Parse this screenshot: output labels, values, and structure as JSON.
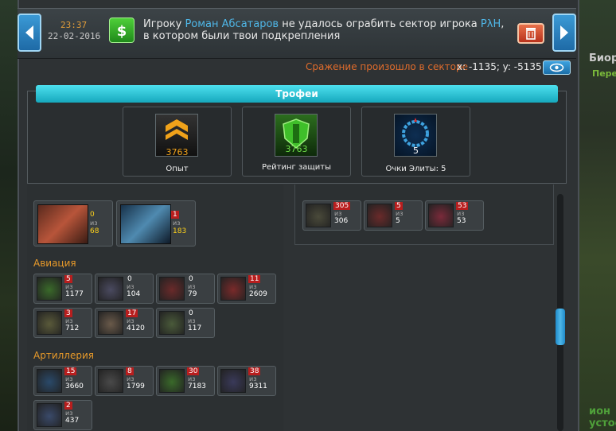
{
  "header": {
    "time": "23:37",
    "date": "22-02-2016",
    "message_prefix": "Игроку",
    "player_victim": "Роман Абсатаров",
    "message_mid": "не удалось ограбить сектор игрока",
    "player_owner": "PλH",
    "message_suffix": "в котором были твои подкрепления",
    "battle_text": "Сражение произошло в секторе",
    "coords": "x: -1135; y: -5135"
  },
  "trophies": {
    "title": "Трофеи",
    "items": [
      {
        "label": "Опыт",
        "value": "3763",
        "icon": "experience-icon"
      },
      {
        "label": "Рейтинг защиты",
        "value": "3763",
        "icon": "shield-rating-icon"
      },
      {
        "label": "Очки Элиты: 5",
        "value": "5",
        "icon": "elite-wreath-icon"
      }
    ]
  },
  "right_side": {
    "title": "Биор",
    "subtitle": "Перер",
    "footer1": "ион",
    "footer2": "устос"
  },
  "units_left": {
    "top": [
      {
        "lost": "0",
        "of": "из",
        "total": "68"
      },
      {
        "lost": "1",
        "of": "из",
        "total": "183"
      }
    ],
    "aviation_title": "Авиация",
    "aviation": [
      {
        "lost": "5",
        "of": "из",
        "total": "1177"
      },
      {
        "lost": "0",
        "of": "из",
        "total": "104"
      },
      {
        "lost": "0",
        "of": "из",
        "total": "79"
      },
      {
        "lost": "11",
        "of": "из",
        "total": "2609"
      },
      {
        "lost": "3",
        "of": "из",
        "total": "712"
      },
      {
        "lost": "17",
        "of": "из",
        "total": "4120"
      },
      {
        "lost": "0",
        "of": "из",
        "total": "117"
      }
    ],
    "artillery_title": "Артиллерия",
    "artillery": [
      {
        "lost": "15",
        "of": "из",
        "total": "3660"
      },
      {
        "lost": "8",
        "of": "из",
        "total": "1799"
      },
      {
        "lost": "30",
        "of": "из",
        "total": "7183"
      },
      {
        "lost": "38",
        "of": "из",
        "total": "9311"
      },
      {
        "lost": "2",
        "of": "из",
        "total": "437"
      }
    ]
  },
  "units_right": [
    {
      "lost": "305",
      "of": "из",
      "total": "306"
    },
    {
      "lost": "5",
      "of": "из",
      "total": "5"
    },
    {
      "lost": "53",
      "of": "из",
      "total": "53"
    }
  ]
}
